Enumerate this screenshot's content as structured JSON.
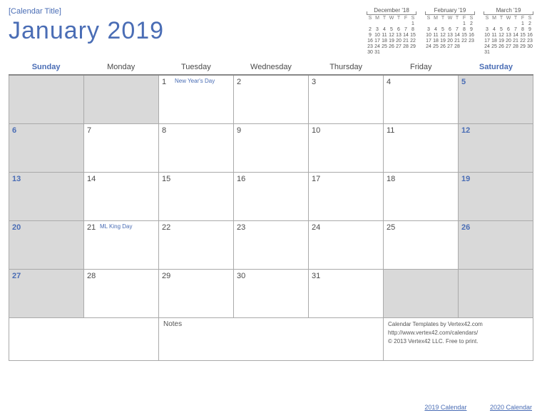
{
  "header": {
    "placeholder": "[Calendar Title]",
    "month": "January  2019"
  },
  "mini": [
    {
      "title": "December '18",
      "head": [
        "S",
        "M",
        "T",
        "W",
        "T",
        "F",
        "S"
      ],
      "rows": [
        [
          "",
          "",
          "",
          "",
          "",
          "",
          "1"
        ],
        [
          "2",
          "3",
          "4",
          "5",
          "6",
          "7",
          "8"
        ],
        [
          "9",
          "10",
          "11",
          "12",
          "13",
          "14",
          "15"
        ],
        [
          "16",
          "17",
          "18",
          "19",
          "20",
          "21",
          "22"
        ],
        [
          "23",
          "24",
          "25",
          "26",
          "27",
          "28",
          "29"
        ],
        [
          "30",
          "31",
          "",
          "",
          "",
          "",
          ""
        ]
      ]
    },
    {
      "title": "February '19",
      "head": [
        "S",
        "M",
        "T",
        "W",
        "T",
        "F",
        "S"
      ],
      "rows": [
        [
          "",
          "",
          "",
          "",
          "",
          "1",
          "2"
        ],
        [
          "3",
          "4",
          "5",
          "6",
          "7",
          "8",
          "9"
        ],
        [
          "10",
          "11",
          "12",
          "13",
          "14",
          "15",
          "16"
        ],
        [
          "17",
          "18",
          "19",
          "20",
          "21",
          "22",
          "23"
        ],
        [
          "24",
          "25",
          "26",
          "27",
          "28",
          "",
          ""
        ]
      ]
    },
    {
      "title": "March '19",
      "head": [
        "S",
        "M",
        "T",
        "W",
        "T",
        "F",
        "S"
      ],
      "rows": [
        [
          "",
          "",
          "",
          "",
          "",
          "1",
          "2"
        ],
        [
          "3",
          "4",
          "5",
          "6",
          "7",
          "8",
          "9"
        ],
        [
          "10",
          "11",
          "12",
          "13",
          "14",
          "15",
          "16"
        ],
        [
          "17",
          "18",
          "19",
          "20",
          "21",
          "22",
          "23"
        ],
        [
          "24",
          "25",
          "26",
          "27",
          "28",
          "29",
          "30"
        ],
        [
          "31",
          "",
          "",
          "",
          "",
          "",
          ""
        ]
      ]
    }
  ],
  "dayHeaders": [
    "Sunday",
    "Monday",
    "Tuesday",
    "Wednesday",
    "Thursday",
    "Friday",
    "Saturday"
  ],
  "cells": [
    {
      "n": "",
      "w": true,
      "e": true
    },
    {
      "n": "",
      "e": true
    },
    {
      "n": "1",
      "ev": "New Year's Day"
    },
    {
      "n": "2"
    },
    {
      "n": "3"
    },
    {
      "n": "4"
    },
    {
      "n": "5",
      "w": true
    },
    {
      "n": "6",
      "w": true
    },
    {
      "n": "7"
    },
    {
      "n": "8"
    },
    {
      "n": "9"
    },
    {
      "n": "10"
    },
    {
      "n": "11"
    },
    {
      "n": "12",
      "w": true
    },
    {
      "n": "13",
      "w": true
    },
    {
      "n": "14"
    },
    {
      "n": "15"
    },
    {
      "n": "16"
    },
    {
      "n": "17"
    },
    {
      "n": "18"
    },
    {
      "n": "19",
      "w": true
    },
    {
      "n": "20",
      "w": true
    },
    {
      "n": "21",
      "ev": "ML King Day"
    },
    {
      "n": "22"
    },
    {
      "n": "23"
    },
    {
      "n": "24"
    },
    {
      "n": "25"
    },
    {
      "n": "26",
      "w": true
    },
    {
      "n": "27",
      "w": true
    },
    {
      "n": "28"
    },
    {
      "n": "29"
    },
    {
      "n": "30"
    },
    {
      "n": "31"
    },
    {
      "n": "",
      "e": true
    },
    {
      "n": "",
      "w": true,
      "e": true
    },
    {
      "n": "",
      "w": true,
      "e": true
    },
    {
      "n": "",
      "e": true
    }
  ],
  "notesLabel": "Notes",
  "credits": {
    "l1": "Calendar Templates by Vertex42.com",
    "l2": "http://www.vertex42.com/calendars/",
    "l3": "© 2013 Vertex42 LLC. Free to print."
  },
  "links": {
    "a": "2019 Calendar",
    "b": "2020 Calendar"
  }
}
